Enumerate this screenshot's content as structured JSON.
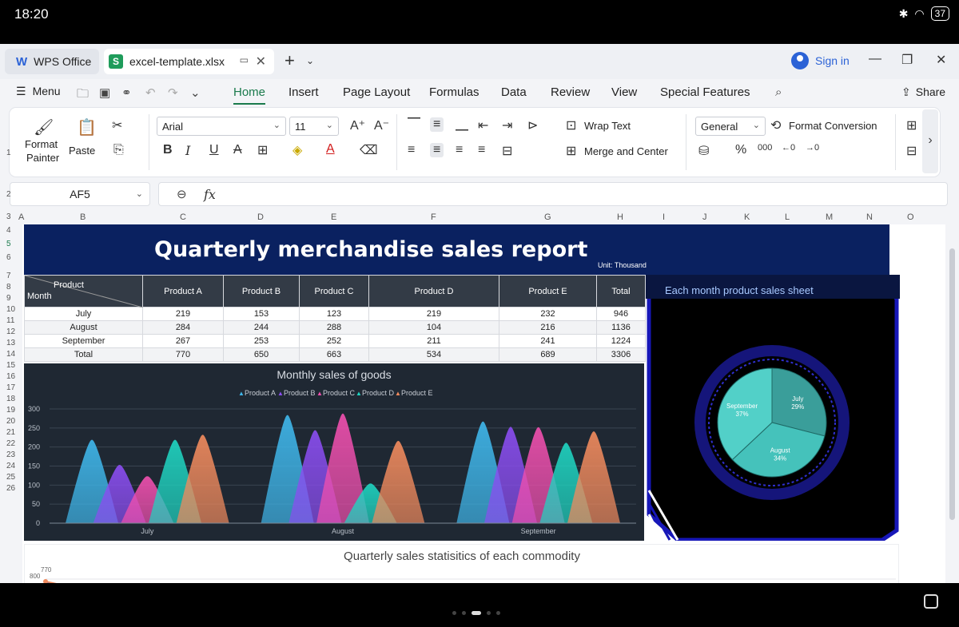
{
  "status": {
    "time": "18:20",
    "battery": "37"
  },
  "tabs": {
    "home": "WPS Office",
    "file": "excel-template.xlsx",
    "file_icon": "S"
  },
  "account": {
    "signin": "Sign in"
  },
  "menu": {
    "label": "Menu",
    "tabs": [
      "Home",
      "Insert",
      "Page Layout",
      "Formulas",
      "Data",
      "Review",
      "View",
      "Special Features"
    ],
    "share": "Share"
  },
  "ribbon": {
    "format_painter": [
      "Format",
      "Painter"
    ],
    "paste": "Paste",
    "font": "Arial",
    "size": "11",
    "wrap": "Wrap Text",
    "merge": "Merge and Center",
    "numfmt": "General",
    "format_conversion": "Format Conversion"
  },
  "formula": {
    "cell": "AF5"
  },
  "columns": [
    "A",
    "B",
    "C",
    "D",
    "E",
    "F",
    "G",
    "H",
    "I",
    "J",
    "K",
    "L",
    "M",
    "N",
    "O"
  ],
  "rows": [
    "1",
    "2",
    "3",
    "4",
    "5",
    "6",
    "7",
    "8",
    "9",
    "10",
    "11",
    "12",
    "13",
    "14",
    "15",
    "16",
    "17",
    "18",
    "19",
    "20",
    "21",
    "22",
    "23",
    "24",
    "25",
    "26"
  ],
  "report": {
    "title": "Quarterly merchandise sales report",
    "unit": "Unit: Thousand",
    "header_product": "Product",
    "header_month": "Month",
    "columns": [
      "Product A",
      "Product B",
      "Product C",
      "Product D",
      "Product E",
      "Total"
    ],
    "rows": [
      {
        "month": "July",
        "values": [
          219,
          153,
          123,
          219,
          232,
          946
        ]
      },
      {
        "month": "August",
        "values": [
          284,
          244,
          288,
          104,
          216,
          1136
        ]
      },
      {
        "month": "September",
        "values": [
          267,
          253,
          252,
          211,
          241,
          1224
        ]
      },
      {
        "month": "Total",
        "values": [
          770,
          650,
          663,
          534,
          689,
          3306
        ]
      }
    ]
  },
  "chart_data": [
    {
      "type": "area",
      "title": "Monthly sales of goods",
      "categories": [
        "July",
        "August",
        "September"
      ],
      "series": [
        {
          "name": "Product A",
          "values": [
            219,
            284,
            267
          ],
          "color": "#3fb6ea"
        },
        {
          "name": "Product B",
          "values": [
            153,
            244,
            253
          ],
          "color": "#8a4df0"
        },
        {
          "name": "Product C",
          "values": [
            123,
            288,
            252
          ],
          "color": "#ef4fae"
        },
        {
          "name": "Product D",
          "values": [
            219,
            104,
            211
          ],
          "color": "#1fd3c0"
        },
        {
          "name": "Product E",
          "values": [
            232,
            216,
            241
          ],
          "color": "#f08a5d"
        }
      ],
      "yticks": [
        0,
        50,
        100,
        150,
        200,
        250,
        300
      ],
      "ylim": [
        0,
        300
      ],
      "legend": "top"
    },
    {
      "type": "pie",
      "title": "Each month product sales sheet",
      "slices": [
        {
          "label": "July",
          "value": 29,
          "color": "#3a9e9a"
        },
        {
          "label": "August",
          "value": 34,
          "color": "#45c2bb"
        },
        {
          "label": "September",
          "value": 37,
          "color": "#52d0c8"
        }
      ],
      "value_suffix": "%"
    },
    {
      "type": "line",
      "title": "Quarterly sales statisitics of each commodity",
      "visible_labels": [
        "770",
        "800"
      ]
    }
  ]
}
